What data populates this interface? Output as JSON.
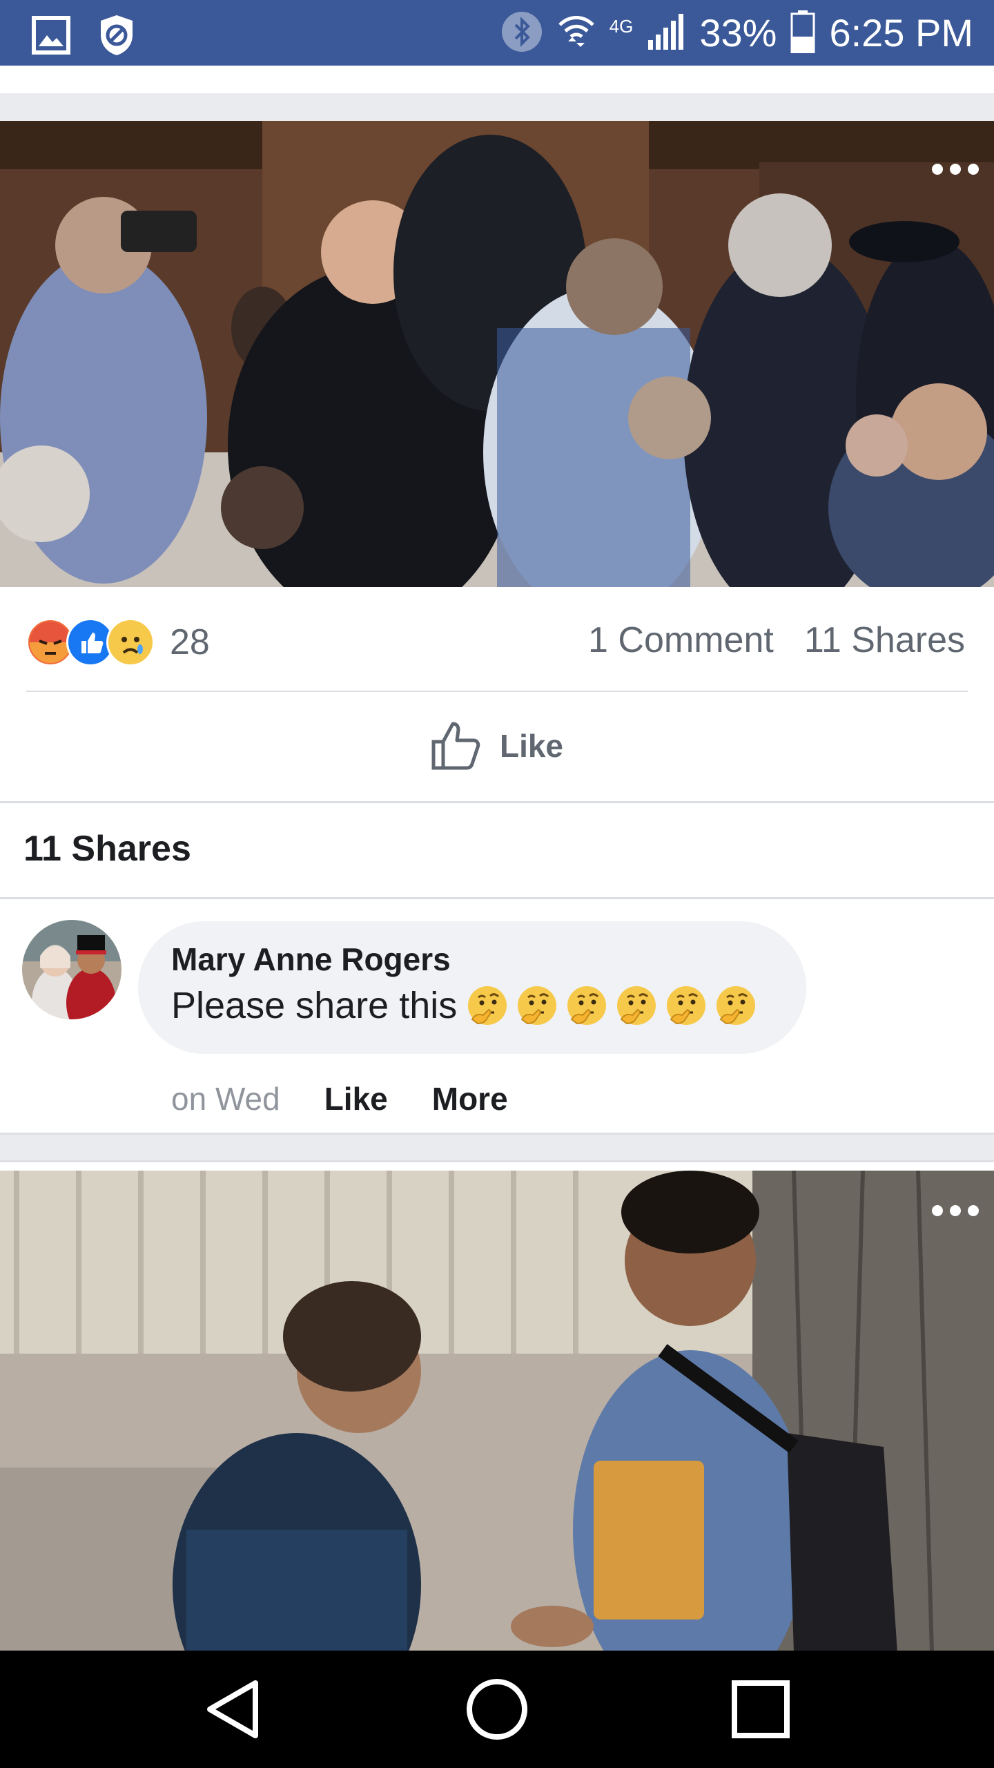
{
  "status_bar": {
    "network": "4G",
    "battery": "33%",
    "time": "6:25 PM",
    "icons": [
      "gallery-icon",
      "shield-icon",
      "bluetooth-icon",
      "wifi-icon",
      "signal-icon",
      "battery-icon"
    ]
  },
  "post1": {
    "reaction_icons": [
      "angry-reaction-icon",
      "like-reaction-icon",
      "sad-reaction-icon"
    ],
    "reaction_count": "28",
    "comments": "1 Comment",
    "shares": "11 Shares",
    "like_label": "Like",
    "shares_header": "11 Shares",
    "comment": {
      "author": "Mary Anne Rogers",
      "text": "Please share this",
      "emoji": "thinking-face-icon",
      "emoji_count": 6,
      "time": "on Wed",
      "like": "Like",
      "more": "More"
    }
  },
  "nav": {
    "buttons": [
      "back-icon",
      "home-icon",
      "recents-icon"
    ]
  },
  "colors": {
    "brand": "#3b5998",
    "like_blue": "#1877f2",
    "muted_text": "#606770"
  }
}
